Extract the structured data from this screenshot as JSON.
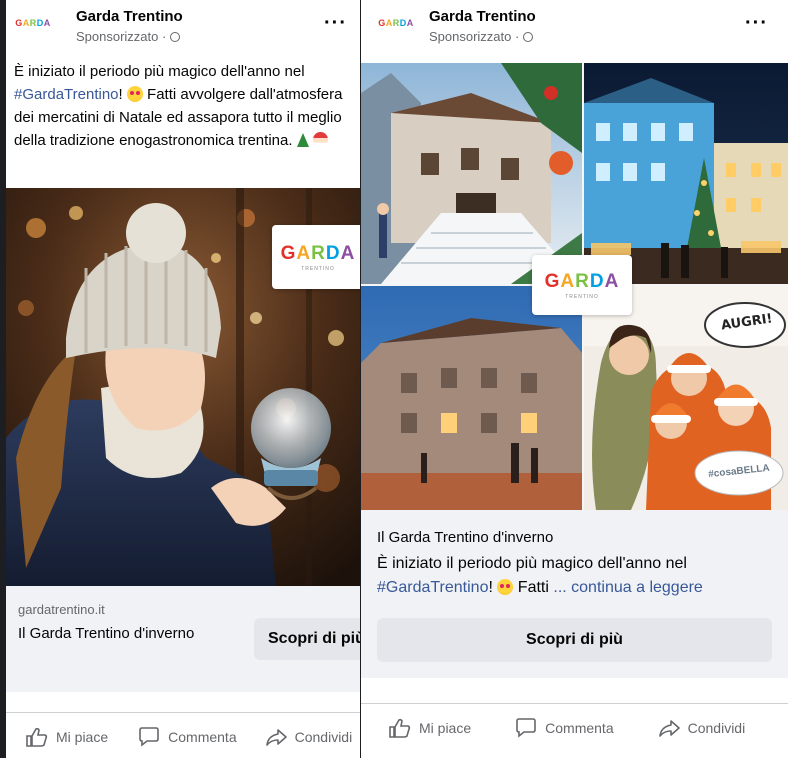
{
  "brand": {
    "logo_letters": [
      "G",
      "A",
      "R",
      "D",
      "A"
    ],
    "logo_colors": [
      "#e4302b",
      "#f5a623",
      "#7ac143",
      "#00a0e3",
      "#8c4fa1"
    ],
    "logo_subtitle": "TRENTINO",
    "link_color": "#385898",
    "muted_color": "#65676b"
  },
  "left_post": {
    "page_name": "Garda Trentino",
    "sponsored": "Sponsorizzato · ",
    "caption_part1": "È iniziato il periodo più magico dell'anno nel ",
    "caption_hashtag": "#GardaTrentino",
    "caption_part2": "! ",
    "caption_part3": " Fatti avvolgere dall'atmosfera dei mercatini di Natale ed assapora tutto il meglio della tradizione enogastronomica trentina. ",
    "domain": "gardatrentino.it",
    "link_title": "Il Garda Trentino d'inverno",
    "cta_label": "Scopri di più",
    "actions": {
      "like": "Mi piace",
      "comment": "Commenta",
      "share": "Condividi"
    }
  },
  "right_post": {
    "page_name": "Garda Trentino",
    "sponsored": "Sponsorizzato · ",
    "link_title": "Il Garda Trentino d'inverno",
    "desc_part1": "È iniziato il periodo più magico dell'anno nel ",
    "desc_hashtag": "#GardaTrentino",
    "desc_part2": "! ",
    "desc_part3": " Fatti  ",
    "see_more": "... continua a leggere",
    "cta_label": "Scopri di più",
    "photo_texts": {
      "sign": "AUGRI!",
      "banner": "#cosaBELLA"
    },
    "actions": {
      "like": "Mi piace",
      "comment": "Commenta",
      "share": "Condividi"
    }
  }
}
